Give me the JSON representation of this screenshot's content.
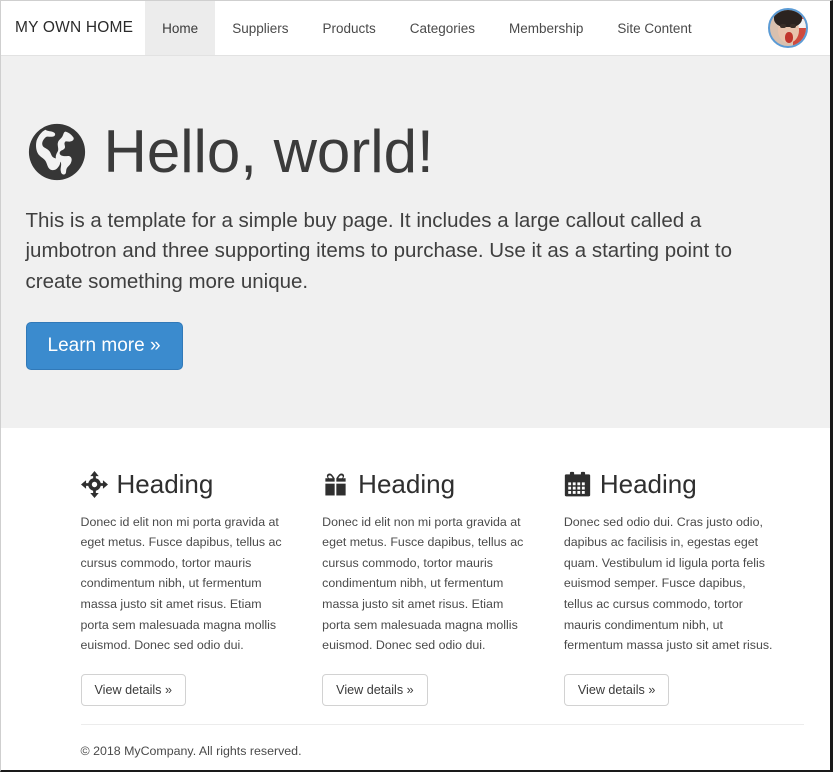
{
  "navbar": {
    "brand": "MY OWN HOME",
    "items": [
      {
        "label": "Home",
        "active": true
      },
      {
        "label": "Suppliers",
        "active": false
      },
      {
        "label": "Products",
        "active": false
      },
      {
        "label": "Categories",
        "active": false
      },
      {
        "label": "Membership",
        "active": false
      },
      {
        "label": "Site Content",
        "active": false
      }
    ],
    "avatar_icon": "user-avatar-image"
  },
  "jumbotron": {
    "icon": "globe-icon",
    "title": "Hello, world!",
    "lead": "This is a template for a simple buy page. It includes a large callout called a jumbotron and three supporting items to purchase. Use it as a starting point to create something more unique.",
    "cta_label": "Learn more »",
    "background": "#f0f0f0",
    "cta_color": "#3b8bce"
  },
  "features": [
    {
      "icon": "crosshairs-icon",
      "heading": "Heading",
      "text": "Donec id elit non mi porta gravida at eget metus. Fusce dapibus, tellus ac cursus commodo, tortor mauris condimentum nibh, ut fermentum massa justo sit amet risus. Etiam porta sem malesuada magna mollis euismod. Donec sed odio dui.",
      "button_label": "View details »"
    },
    {
      "icon": "gift-icon",
      "heading": "Heading",
      "text": "Donec id elit non mi porta gravida at eget metus. Fusce dapibus, tellus ac cursus commodo, tortor mauris condimentum nibh, ut fermentum massa justo sit amet risus. Etiam porta sem malesuada magna mollis euismod. Donec sed odio dui.",
      "button_label": "View details »"
    },
    {
      "icon": "calendar-icon",
      "heading": "Heading",
      "text": "Donec sed odio dui. Cras justo odio, dapibus ac facilisis in, egestas eget quam. Vestibulum id ligula porta felis euismod semper. Fusce dapibus, tellus ac cursus commodo, tortor mauris condimentum nibh, ut fermentum massa justo sit amet risus.",
      "button_label": "View details »"
    }
  ],
  "footer": {
    "copyright": "© 2018 MyCompany. All rights reserved."
  }
}
